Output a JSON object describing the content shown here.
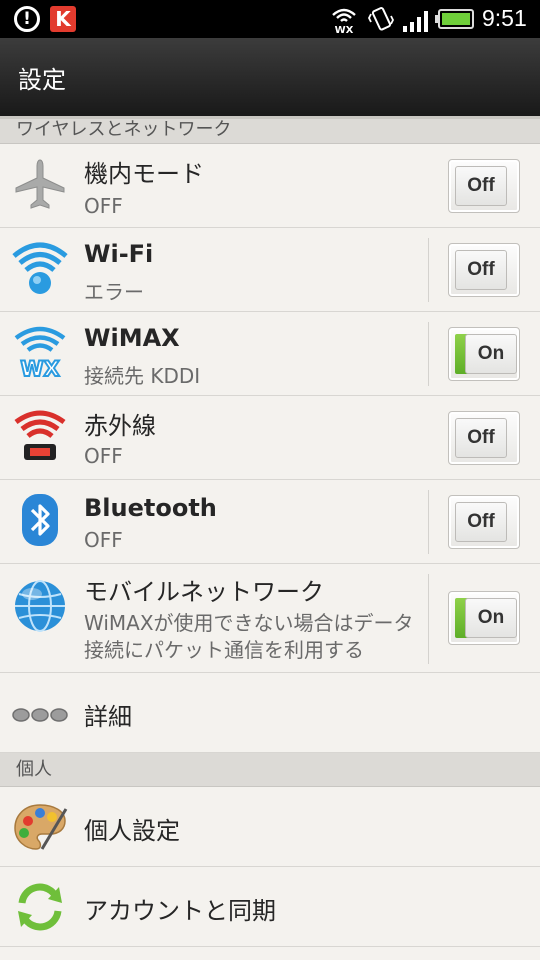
{
  "status_bar": {
    "alert_glyph": "!",
    "k_glyph": "K",
    "time": "9:51",
    "icons": [
      "alert-icon",
      "k-app-icon",
      "wimax-signal-icon",
      "vibrate-icon",
      "cell-signal-icon",
      "battery-icon"
    ]
  },
  "header": {
    "title": "設定"
  },
  "sections": [
    {
      "title": "ワイヤレスとネットワーク"
    },
    {
      "title": "個人"
    }
  ],
  "rows": [
    {
      "title": "機内モード",
      "subtitle": "OFF",
      "toggle": "Off",
      "icon": "airplane-icon"
    },
    {
      "title": "Wi-Fi",
      "subtitle": "エラー",
      "toggle": "Off",
      "icon": "wifi-icon"
    },
    {
      "title": "WiMAX",
      "subtitle": "接続先 KDDI",
      "toggle": "On",
      "icon": "wimax-icon"
    },
    {
      "title": "赤外線",
      "subtitle": "OFF",
      "toggle": "Off",
      "icon": "infrared-icon"
    },
    {
      "title": "Bluetooth",
      "subtitle": "OFF",
      "toggle": "Off",
      "icon": "bluetooth-icon"
    },
    {
      "title": "モバイルネットワーク",
      "subtitle": "WiMAXが使用できない場合はデータ接続にパケット通信を利用する",
      "toggle": "On",
      "icon": "globe-icon"
    },
    {
      "title": "詳細",
      "icon": "more-dots-icon"
    },
    {
      "title": "個人設定",
      "icon": "palette-icon"
    },
    {
      "title": "アカウントと同期",
      "icon": "sync-icon"
    }
  ],
  "colors": {
    "background": "#f4f2ee",
    "toggle_on": "#6fbe33",
    "infrared": "#d9302b",
    "wifi_blue": "#2a9be0"
  }
}
